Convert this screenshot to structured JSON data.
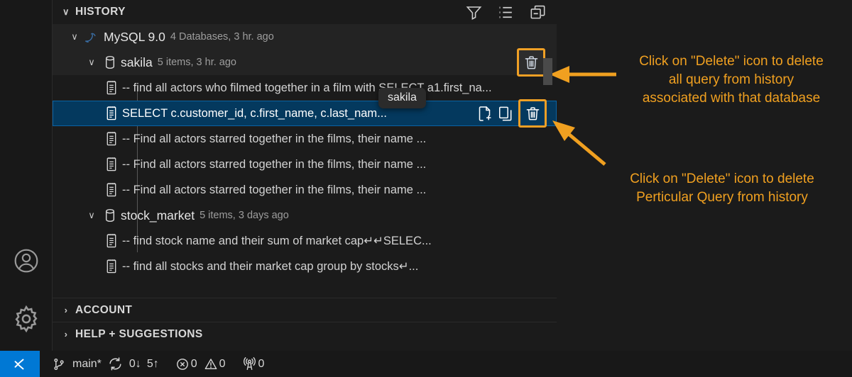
{
  "window": {
    "background": "#1b1b1b",
    "accent": "#f0a020",
    "selection": "#04395e"
  },
  "activity_bar": {
    "items": [
      {
        "name": "account-icon",
        "label": "Accounts"
      },
      {
        "name": "gear-icon",
        "label": "Manage"
      }
    ]
  },
  "sidebar": {
    "sections": [
      {
        "id": "history",
        "title": "HISTORY",
        "expanded": true,
        "chevron": "∨"
      },
      {
        "id": "account",
        "title": "ACCOUNT",
        "expanded": false,
        "chevron": "›"
      },
      {
        "id": "help",
        "title": "HELP + SUGGESTIONS",
        "expanded": false,
        "chevron": "›"
      }
    ],
    "history_actions": [
      {
        "name": "filter-icon",
        "label": "Filter"
      },
      {
        "name": "list-icon",
        "label": "List View"
      },
      {
        "name": "collapse-all-icon",
        "label": "Collapse All"
      }
    ]
  },
  "tree": {
    "connection": {
      "chevron": "∨",
      "icon": "mysql-dolphin-icon",
      "name": "MySQL 9.0",
      "meta": "4 Databases, 3 hr. ago"
    },
    "databases": [
      {
        "chevron": "∨",
        "icon": "database-icon",
        "name": "sakila",
        "meta": "5 items, 3 hr. ago",
        "delete_label": "Delete",
        "delete_highlighted": true,
        "queries": [
          {
            "icon": "query-file-icon",
            "text": "-- find all actors who filmed together in a film with SELECT a1.first_na...",
            "selected": false
          },
          {
            "icon": "query-file-icon",
            "text": "SELECT c.customer_id, c.first_name, c.last_nam...",
            "selected": true,
            "actions": [
              {
                "name": "open-in-new-editor-icon",
                "label": "Open Query in New Editor"
              },
              {
                "name": "copy-icon",
                "label": "Copy Query"
              },
              {
                "name": "delete-icon",
                "label": "Delete",
                "highlighted": true
              }
            ]
          },
          {
            "icon": "query-file-icon",
            "text": "-- Find all actors starred together in the films, their name ...",
            "selected": false
          },
          {
            "icon": "query-file-icon",
            "text": "-- Find all actors starred together in the films, their name ...",
            "selected": false
          },
          {
            "icon": "query-file-icon",
            "text": "-- Find all actors starred together in the films, their name ...",
            "selected": false
          }
        ]
      },
      {
        "chevron": "∨",
        "icon": "database-icon",
        "name": "stock_market",
        "meta": "5 items, 3 days ago",
        "queries": [
          {
            "icon": "query-file-icon",
            "text": "-- find stock name and their sum of market cap↵↵SELEC...",
            "selected": false
          },
          {
            "icon": "query-file-icon",
            "text": "-- find all stocks and their market cap group by stocks↵...",
            "selected": false
          }
        ]
      }
    ],
    "tooltip": {
      "text": "sakila"
    }
  },
  "annotations": [
    {
      "id": "annot-db-delete",
      "text": "Click on \"Delete\" icon to delete\nall query from history\nassociated with that database",
      "color": "#f0a020"
    },
    {
      "id": "annot-query-delete",
      "text": "Click on \"Delete\" icon to delete\nPerticular Query from history",
      "color": "#f0a020"
    }
  ],
  "status_bar": {
    "remote_icon": "remote-window-icon",
    "branch_icon": "source-control-branch-icon",
    "branch": "main*",
    "sync_icon": "sync-icon",
    "sync_down": "0↓",
    "sync_up": "5↑",
    "error_icon": "error-icon",
    "errors": "0",
    "warning_icon": "warning-icon",
    "warnings": "0",
    "radio_icon": "radio-tower-icon",
    "radio_count": "0"
  }
}
